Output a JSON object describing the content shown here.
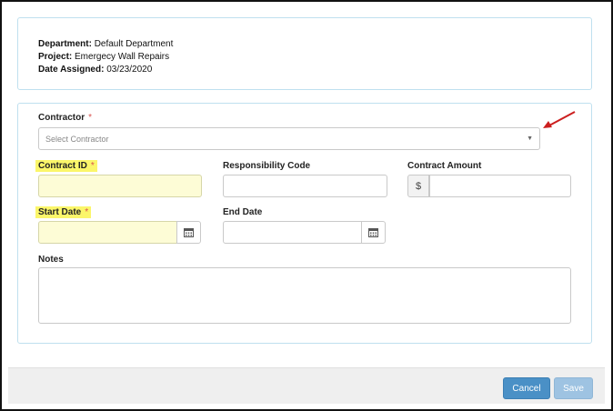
{
  "info": {
    "department_label": "Department:",
    "department_value": "Default Department",
    "project_label": "Project:",
    "project_value": "Emergecy Wall Repairs",
    "date_label": "Date Assigned:",
    "date_value": "03/23/2020"
  },
  "form": {
    "contractor_label": "Contractor",
    "contractor_placeholder": "Select Contractor",
    "required_mark": "*",
    "contract_id_label": "Contract ID",
    "responsibility_code_label": "Responsibility Code",
    "contract_amount_label": "Contract Amount",
    "currency_symbol": "$",
    "start_date_label": "Start Date",
    "end_date_label": "End Date",
    "notes_label": "Notes"
  },
  "buttons": {
    "cancel": "Cancel",
    "save": "Save"
  },
  "icons": {
    "calendar": "calendar-icon",
    "dropdown": "chevron-down-icon",
    "annotation": "red-arrow-icon"
  },
  "colors": {
    "highlight": "#fbf66a",
    "required": "#d9534f",
    "primary_button": "#4a90c6",
    "disabled_button": "#9ec3e2"
  }
}
